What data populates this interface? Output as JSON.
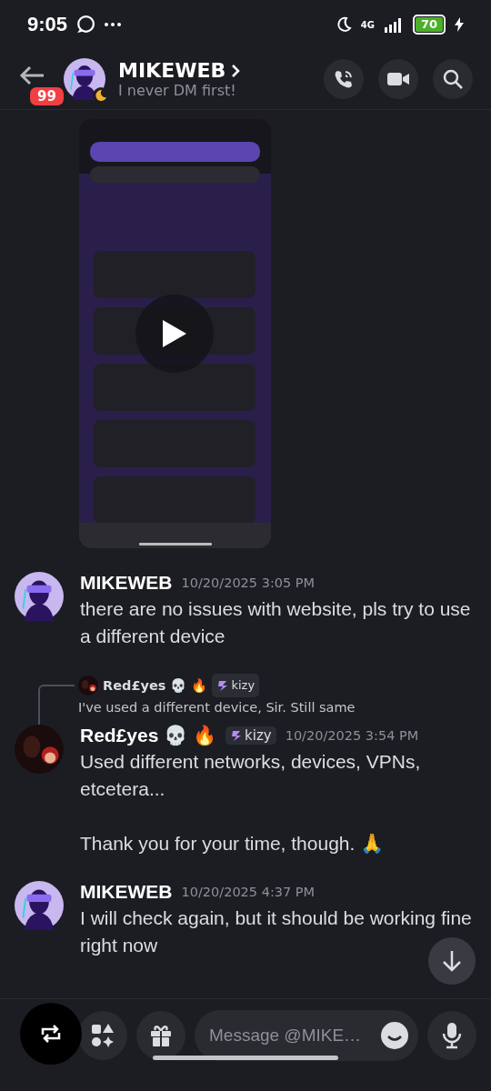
{
  "status_bar": {
    "time": "9:05",
    "network": "4G",
    "battery": "70"
  },
  "header": {
    "unread": "99",
    "name": "MIKEWEB",
    "status": "I never DM first!"
  },
  "messages": [
    {
      "author": "MIKEWEB",
      "kind": "visor",
      "timestamp": "10/20/2025 3:05 PM",
      "text": "there are no issues with website, pls try to use a different device"
    },
    {
      "author": "Red£yes 💀 🔥",
      "kind": "dark",
      "tag": "kizy",
      "timestamp": "10/20/2025 3:54 PM",
      "reply": {
        "author": "Red£yes 💀 🔥",
        "tag": "kizy",
        "text": "I've used a different device, Sir. Still same"
      },
      "text": "Used different networks, devices, VPNs, etcetera...\n\nThank you for your time, though. 🙏"
    },
    {
      "author": "MIKEWEB",
      "kind": "visor",
      "timestamp": "10/20/2025 4:37 PM",
      "text": "I will check again, but it should be working fine right now"
    }
  ],
  "composer": {
    "placeholder": "Message @MIKE…"
  }
}
